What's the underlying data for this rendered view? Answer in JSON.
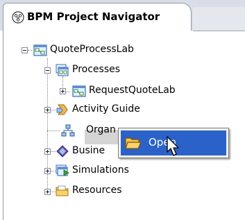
{
  "panel": {
    "title": "BPM Project Navigator",
    "icon": "navigator-icon"
  },
  "tree": {
    "project": {
      "label": "QuoteProcessLab",
      "icon": "project-icon",
      "expanded": true
    },
    "processes": {
      "label": "Processes",
      "icon": "processes-folder-icon",
      "expanded": true
    },
    "request_quote": {
      "label": "RequestQuoteLab",
      "icon": "process-icon",
      "expanded": false
    },
    "activity_guide": {
      "label": "Activity Guide",
      "icon": "activity-guide-icon",
      "expanded": false
    },
    "organization": {
      "label": "Organ",
      "icon": "organization-icon",
      "selected": true
    },
    "business": {
      "label": "Busine",
      "icon": "business-catalog-icon",
      "expanded": false
    },
    "simulations": {
      "label": "Simulations",
      "icon": "simulations-icon",
      "expanded": false
    },
    "resources": {
      "label": "Resources",
      "icon": "resources-folder-icon",
      "expanded": false
    }
  },
  "context_menu": {
    "items": [
      {
        "label": "Open",
        "icon": "open-folder-icon",
        "highlighted": true
      }
    ]
  },
  "colors": {
    "menu_highlight": "#2a62c9",
    "selection": "#d4d4d4",
    "tab_strip": "#d8dde6"
  },
  "cursor": {
    "icon": "pointer-cursor-icon"
  }
}
